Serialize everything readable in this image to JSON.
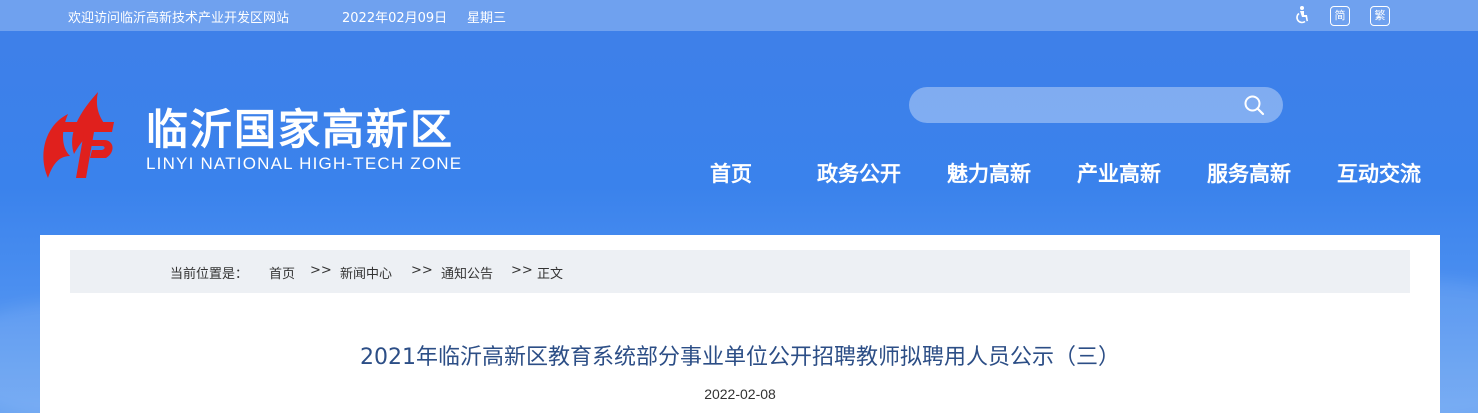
{
  "topbar": {
    "welcome": "欢迎访问临沂高新技术产业开发区网站",
    "date": "2022年02月09日",
    "weekday": "星期三",
    "simplified_label": "简",
    "traditional_label": "繁"
  },
  "header": {
    "title": "临沂国家高新区",
    "subtitle": "LINYI NATIONAL HIGH-TECH ZONE",
    "search_placeholder": ""
  },
  "nav": {
    "items": [
      {
        "label": "首页"
      },
      {
        "label": "政务公开"
      },
      {
        "label": "魅力高新"
      },
      {
        "label": "产业高新"
      },
      {
        "label": "服务高新"
      },
      {
        "label": "互动交流"
      }
    ]
  },
  "breadcrumb": {
    "prefix": "当前位置是：",
    "items": [
      "首页",
      "新闻中心",
      "通知公告",
      "正文"
    ],
    "separator": ">>"
  },
  "article": {
    "title": "2021年临沂高新区教育系统部分事业单位公开招聘教师拟聘用人员公示（三）",
    "date": "2022-02-08"
  },
  "colors": {
    "header_bg": "#3f7fe8",
    "topbar_bg": "#6fa1ef",
    "logo_red": "#e0201d",
    "title_blue": "#2c4e86",
    "breadcrumb_bg": "#edf0f4"
  }
}
